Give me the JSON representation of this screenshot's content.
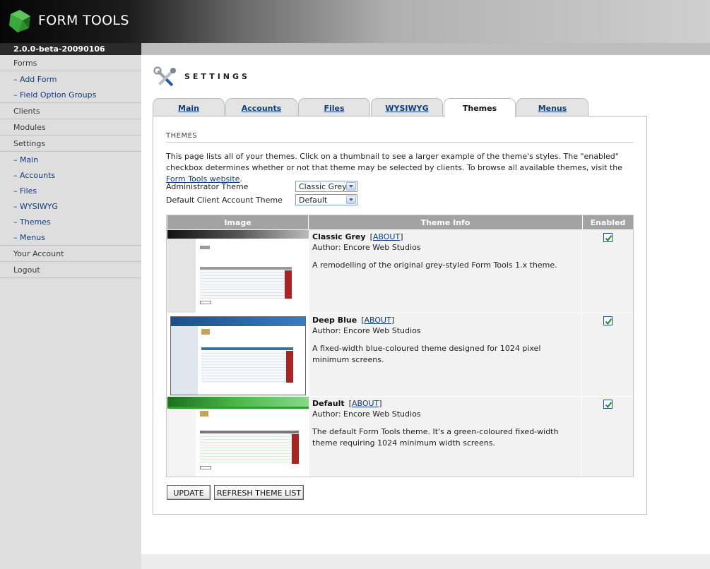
{
  "app": {
    "logo_text": "FORM TOOLS",
    "version": "2.0.0-beta-20090106"
  },
  "sidebar": {
    "items": [
      {
        "label": "Forms",
        "type": "top"
      },
      {
        "label": "– Add Form",
        "type": "sub"
      },
      {
        "label": "– Field Option Groups",
        "type": "sub"
      },
      {
        "label": "Clients",
        "type": "top"
      },
      {
        "label": "Modules",
        "type": "top"
      },
      {
        "label": "Settings",
        "type": "top"
      },
      {
        "label": "– Main",
        "type": "sub"
      },
      {
        "label": "– Accounts",
        "type": "sub"
      },
      {
        "label": "– Files",
        "type": "sub"
      },
      {
        "label": "– WYSIWYG",
        "type": "sub"
      },
      {
        "label": "– Themes",
        "type": "sub"
      },
      {
        "label": "– Menus",
        "type": "sub"
      },
      {
        "label": "Your Account",
        "type": "top"
      },
      {
        "label": "Logout",
        "type": "top"
      }
    ]
  },
  "page": {
    "title": "SETTINGS",
    "icon": "tools-icon"
  },
  "tabs": [
    {
      "label": "Main",
      "active": false
    },
    {
      "label": "Accounts",
      "active": false
    },
    {
      "label": "Files",
      "active": false
    },
    {
      "label": "WYSIWYG",
      "active": false
    },
    {
      "label": "Themes",
      "active": true
    },
    {
      "label": "Menus",
      "active": false
    }
  ],
  "section": {
    "heading": "THEMES",
    "intro_text": "This page lists all of your themes. Click on a thumbnail to see a larger example of the theme's styles. The \"enabled\" checkbox determines whether or not that theme may be selected by clients. To browse all available themes, visit the ",
    "intro_link": "Form Tools website",
    "intro_end": "."
  },
  "fields": {
    "admin_theme_label": "Administrator Theme",
    "admin_theme_value": "Classic Grey",
    "client_theme_label": "Default Client Account Theme",
    "client_theme_value": "Default"
  },
  "table": {
    "columns": [
      "Image",
      "Theme Info",
      "Enabled"
    ],
    "rows": [
      {
        "name": "Classic Grey",
        "about": "ABOUT",
        "author": "Author: Encore Web Studios",
        "description": "A remodelling of the original grey-styled Form Tools 1.x theme.",
        "enabled": true,
        "preview_style": "grey"
      },
      {
        "name": "Deep Blue",
        "about": "ABOUT",
        "author": "Author: Encore Web Studios",
        "description": "A fixed-width blue-coloured theme designed for 1024 pixel minimum screens.",
        "enabled": true,
        "preview_style": "blue"
      },
      {
        "name": "Default",
        "about": "ABOUT",
        "author": "Author: Encore Web Studios",
        "description": "The default Form Tools theme. It's a green-coloured fixed-width theme requiring 1024 minimum width screens.",
        "enabled": true,
        "preview_style": "green"
      }
    ]
  },
  "buttons": {
    "update": "UPDATE",
    "refresh": "REFRESH THEME LIST"
  },
  "colors": {
    "link": "#123c7c",
    "table_header": "#a3a3a3",
    "sidebar_bg": "#dedede",
    "accent_green": "#2e9e2e"
  }
}
